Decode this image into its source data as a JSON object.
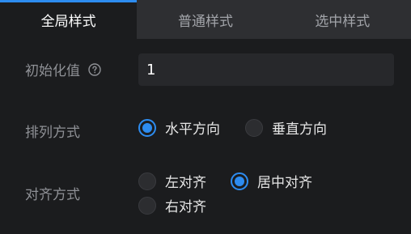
{
  "tabs": [
    {
      "label": "全局样式",
      "active": true
    },
    {
      "label": "普通样式",
      "active": false
    },
    {
      "label": "选中样式",
      "active": false
    }
  ],
  "init_value": {
    "label": "初始化值",
    "help_icon": "question-circle-icon",
    "value": "1"
  },
  "layout": {
    "label": "排列方式",
    "options": [
      {
        "label": "水平方向",
        "checked": true
      },
      {
        "label": "垂直方向",
        "checked": false
      }
    ]
  },
  "align": {
    "label": "对齐方式",
    "options": [
      {
        "label": "左对齐",
        "checked": false
      },
      {
        "label": "居中对齐",
        "checked": true
      },
      {
        "label": "右对齐",
        "checked": false
      }
    ]
  },
  "colors": {
    "accent": "#2d8cf0",
    "background": "#1b1c1e"
  }
}
